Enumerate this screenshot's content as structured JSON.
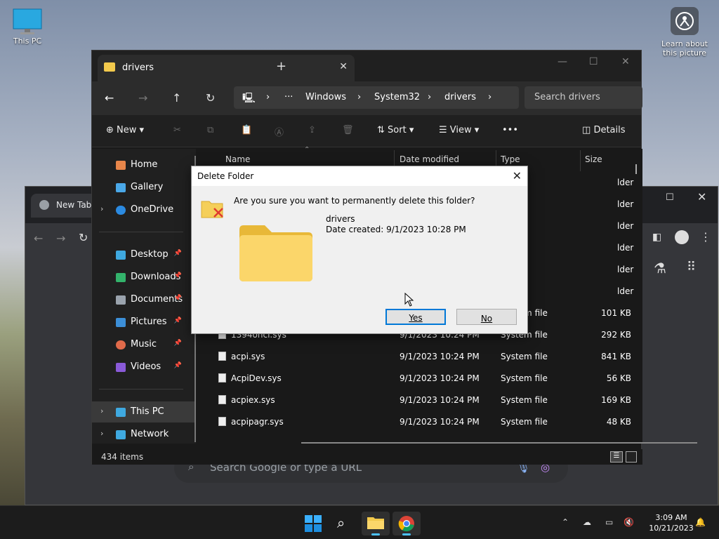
{
  "desktop": {
    "this_pc_label": "This PC",
    "learn_label": "Learn about this picture"
  },
  "chrome": {
    "tab_title": "New Tab",
    "search_placeholder": "Search Google or type a URL"
  },
  "explorer": {
    "tab_title": "drivers",
    "breadcrumb": [
      "Windows",
      "System32",
      "drivers"
    ],
    "search_placeholder": "Search drivers",
    "commands": {
      "new": "New",
      "sort": "Sort",
      "view": "View",
      "details": "Details"
    },
    "sidebar": [
      {
        "label": "Home",
        "icon": "home-icon"
      },
      {
        "label": "Gallery",
        "icon": "gallery-icon"
      },
      {
        "label": "OneDrive",
        "icon": "cloud-icon"
      },
      {
        "label": "Desktop",
        "icon": "desktop-icon"
      },
      {
        "label": "Downloads",
        "icon": "download-icon"
      },
      {
        "label": "Documents",
        "icon": "documents-icon"
      },
      {
        "label": "Pictures",
        "icon": "pictures-icon"
      },
      {
        "label": "Music",
        "icon": "music-icon"
      },
      {
        "label": "Videos",
        "icon": "videos-icon"
      },
      {
        "label": "This PC",
        "icon": "pc-icon"
      },
      {
        "label": "Network",
        "icon": "network-icon"
      }
    ],
    "columns": [
      "Name",
      "Date modified",
      "Type",
      "Size"
    ],
    "partial_type_text": "lder",
    "rows": [
      {
        "name": "",
        "date": "",
        "type": "System file",
        "size": "101 KB"
      },
      {
        "name": "1394ohci.sys",
        "date": "9/1/2023 10:24 PM",
        "type": "System file",
        "size": "292 KB"
      },
      {
        "name": "acpi.sys",
        "date": "9/1/2023 10:24 PM",
        "type": "System file",
        "size": "841 KB"
      },
      {
        "name": "AcpiDev.sys",
        "date": "9/1/2023 10:24 PM",
        "type": "System file",
        "size": "56 KB"
      },
      {
        "name": "acpiex.sys",
        "date": "9/1/2023 10:24 PM",
        "type": "System file",
        "size": "169 KB"
      },
      {
        "name": "acpipagr.sys",
        "date": "9/1/2023 10:24 PM",
        "type": "System file",
        "size": "48 KB"
      }
    ],
    "status": "434 items"
  },
  "dialog": {
    "title": "Delete Folder",
    "question": "Are you sure you want to permanently delete this folder?",
    "folder_name": "drivers",
    "date_created": "Date created: 9/1/2023 10:28 PM",
    "yes_label": "Yes",
    "no_label": "No"
  },
  "taskbar": {
    "time": "3:09 AM",
    "date": "10/21/2023"
  },
  "colors": {
    "accent": "#0078d7",
    "folder_yellow": "#f2c94c"
  }
}
